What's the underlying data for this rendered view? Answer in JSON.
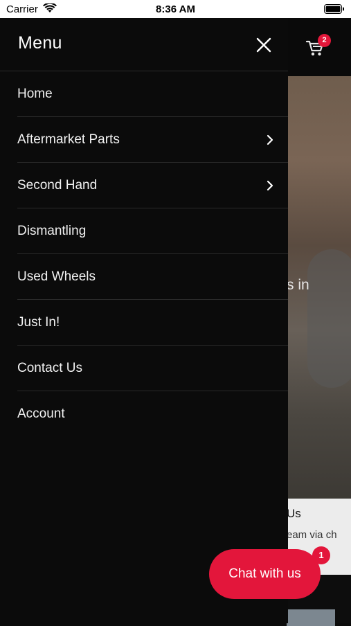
{
  "status_bar": {
    "carrier": "Carrier",
    "time": "8:36 AM"
  },
  "background_page": {
    "cart_count": "2",
    "hero_text_fragment": "s in",
    "card_title_fragment": "Us",
    "card_text_fragment": "eam via ch"
  },
  "drawer": {
    "title": "Menu",
    "items": [
      {
        "label": "Home",
        "has_submenu": false
      },
      {
        "label": "Aftermarket Parts",
        "has_submenu": true
      },
      {
        "label": "Second Hand",
        "has_submenu": true
      },
      {
        "label": "Dismantling",
        "has_submenu": false
      },
      {
        "label": "Used Wheels",
        "has_submenu": false
      },
      {
        "label": "Just In!",
        "has_submenu": false
      },
      {
        "label": "Contact Us",
        "has_submenu": false
      },
      {
        "label": "Account",
        "has_submenu": false
      }
    ]
  },
  "chat": {
    "label": "Chat with us",
    "badge_count": "1"
  },
  "colors": {
    "accent": "#e3163b",
    "drawer_bg": "#0b0b0b",
    "divider": "#2a2a2a"
  },
  "icons": [
    "wifi-icon",
    "battery-icon",
    "close-icon",
    "cart-icon",
    "chevron-right-icon"
  ]
}
